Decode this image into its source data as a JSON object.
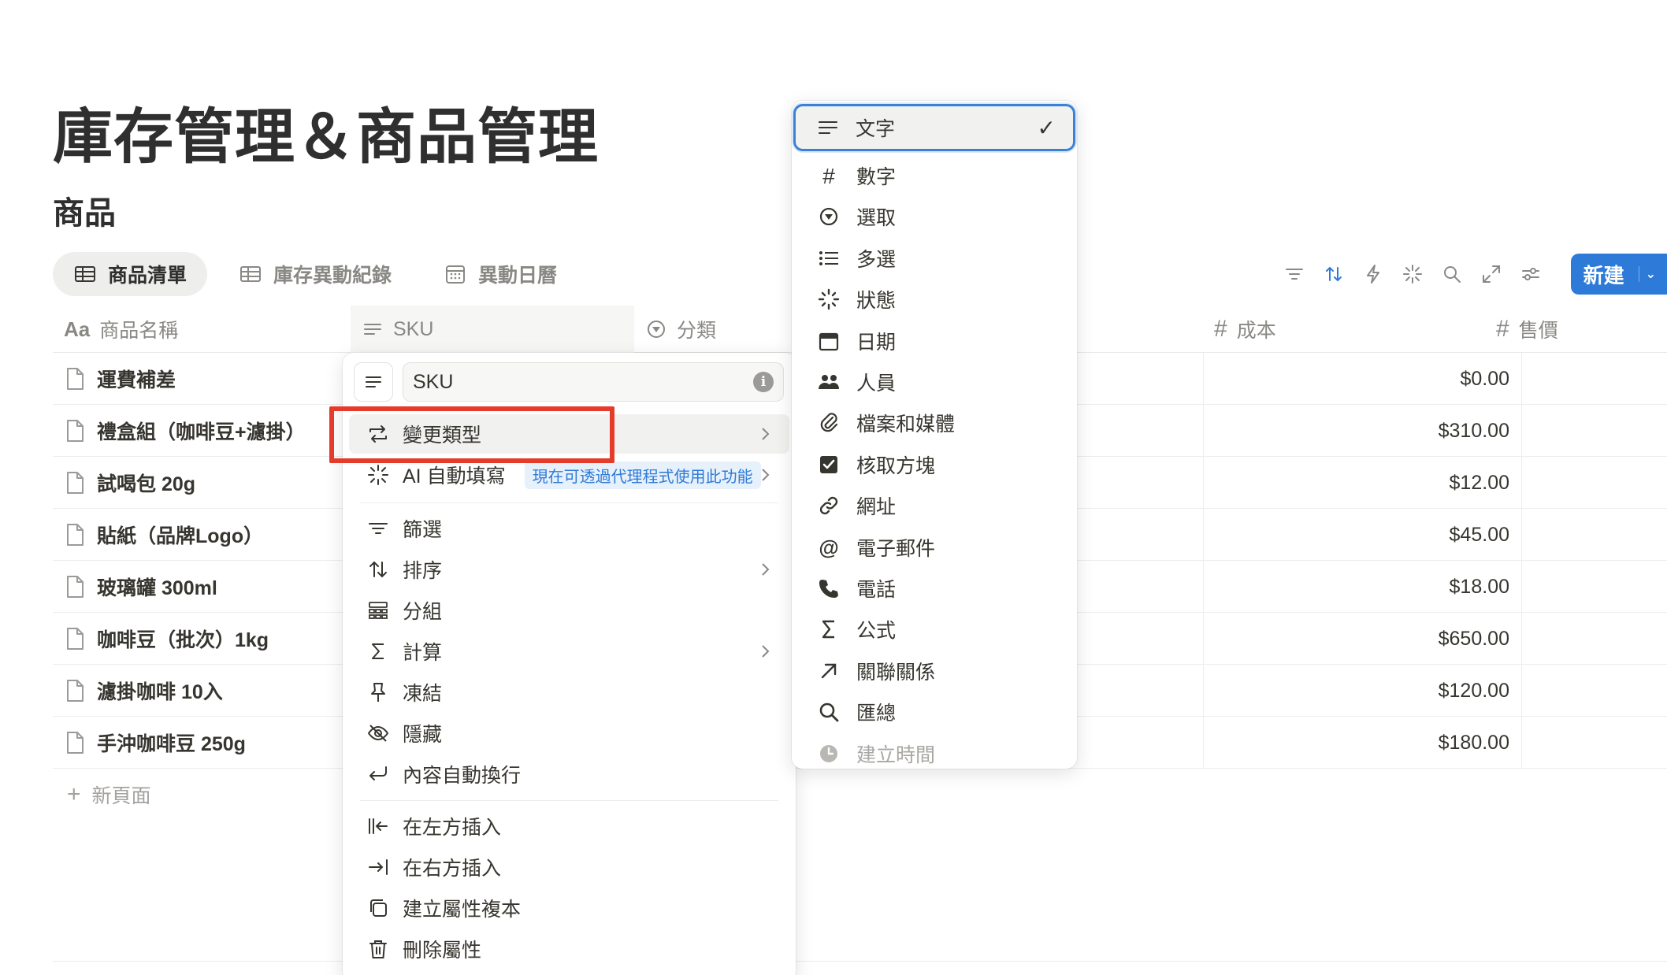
{
  "page": {
    "title": "庫存管理＆商品管理",
    "database_title": "商品"
  },
  "tabs": [
    {
      "label": "商品清單",
      "icon": "table-icon",
      "active": true
    },
    {
      "label": "庫存異動紀錄",
      "icon": "table-icon",
      "active": false
    },
    {
      "label": "異動日曆",
      "icon": "calendar-icon",
      "active": false
    }
  ],
  "toolbar": {
    "icons": [
      "filter-icon",
      "sort-icon",
      "automation-icon",
      "ai-sparkle-icon",
      "search-icon",
      "expand-icon",
      "settings-icon"
    ],
    "new_button_label": "新建",
    "accent_color": "#2e7ad8"
  },
  "table": {
    "columns": {
      "name": "商品名稱",
      "sku": "SKU",
      "category": "分類",
      "cost": "成本",
      "price": "售價"
    },
    "rows": [
      {
        "name": "運費補差",
        "cost": "$0.00"
      },
      {
        "name": "禮盒組（咖啡豆+濾掛）",
        "cost": "$310.00"
      },
      {
        "name": "試喝包 20g",
        "cost": "$12.00"
      },
      {
        "name": "貼紙（品牌Logo）",
        "cost": "$45.00"
      },
      {
        "name": "玻璃罐 300ml",
        "cost": "$18.00"
      },
      {
        "name": "咖啡豆（批次）1kg",
        "cost": "$650.00"
      },
      {
        "name": "濾掛咖啡 10入",
        "cost": "$120.00"
      },
      {
        "name": "手沖咖啡豆 250g",
        "cost": "$180.00"
      }
    ],
    "new_page_label": "新頁面"
  },
  "property_menu": {
    "name_value": "SKU",
    "change_type": "變更類型",
    "ai_autofill": "AI 自動填寫",
    "ai_badge": "現在可透過代理程式使用此功能",
    "filter": "篩選",
    "sort": "排序",
    "group": "分組",
    "calculate": "計算",
    "freeze": "凍結",
    "hide": "隱藏",
    "wrap": "內容自動換行",
    "insert_left": "在左方插入",
    "insert_right": "在右方插入",
    "duplicate": "建立屬性複本",
    "delete": "刪除屬性",
    "highlight_color": "#e43b2a"
  },
  "type_menu": {
    "items": [
      {
        "label": "文字",
        "icon": "text-icon",
        "selected": true
      },
      {
        "label": "數字",
        "icon": "number-icon"
      },
      {
        "label": "選取",
        "icon": "select-icon"
      },
      {
        "label": "多選",
        "icon": "multi-select-icon"
      },
      {
        "label": "狀態",
        "icon": "status-icon"
      },
      {
        "label": "日期",
        "icon": "date-icon"
      },
      {
        "label": "人員",
        "icon": "people-icon"
      },
      {
        "label": "檔案和媒體",
        "icon": "attachment-icon"
      },
      {
        "label": "核取方塊",
        "icon": "checkbox-icon"
      },
      {
        "label": "網址",
        "icon": "link-icon"
      },
      {
        "label": "電子郵件",
        "icon": "email-icon"
      },
      {
        "label": "電話",
        "icon": "phone-icon"
      },
      {
        "label": "公式",
        "icon": "formula-icon"
      },
      {
        "label": "關聯關係",
        "icon": "relation-icon"
      },
      {
        "label": "匯總",
        "icon": "rollup-icon"
      },
      {
        "label": "建立時間",
        "icon": "created-time-icon"
      }
    ],
    "check_mark": "✓",
    "selected_border_color": "#3b82d6"
  }
}
